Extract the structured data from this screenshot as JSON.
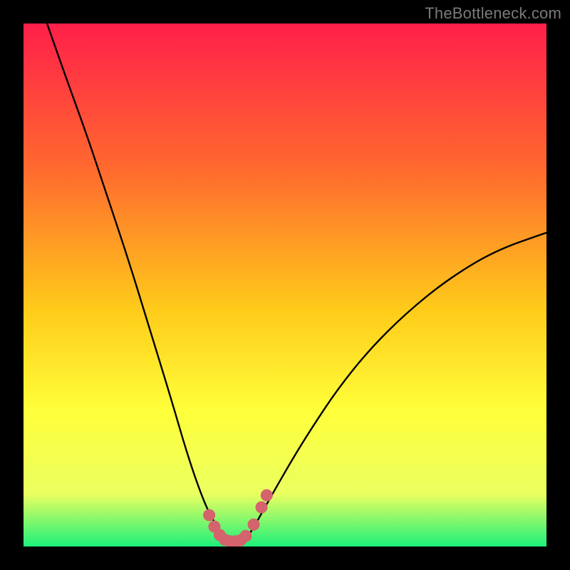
{
  "watermark": "TheBottleneck.com",
  "colors": {
    "bg_black": "#000000",
    "grad_top": "#ff1f4a",
    "grad_mid1": "#ff6a2e",
    "grad_mid2": "#ffcc1a",
    "grad_mid3": "#ffff3a",
    "grad_mid4": "#eaff60",
    "grad_bottom": "#1df07a",
    "curve": "#000000",
    "marker_fill": "#d5636d",
    "marker_stroke": "#d5636d",
    "watermark": "#7a7a7a"
  },
  "chart_data": {
    "type": "line",
    "title": "",
    "xlabel": "",
    "ylabel": "",
    "xlim": [
      0,
      1
    ],
    "ylim": [
      0,
      1
    ],
    "legend": false,
    "grid": false,
    "series": [
      {
        "name": "curve",
        "comment": "black v-shaped curve; x in [0,1], y = relative height (0 bottom, 1 top)",
        "x": [
          0.045,
          0.08,
          0.12,
          0.16,
          0.2,
          0.24,
          0.28,
          0.315,
          0.345,
          0.365,
          0.385,
          0.4,
          0.415,
          0.43,
          0.445,
          0.47,
          0.51,
          0.55,
          0.6,
          0.66,
          0.73,
          0.81,
          0.9,
          1.0
        ],
        "y": [
          1.0,
          0.9,
          0.79,
          0.67,
          0.55,
          0.42,
          0.29,
          0.17,
          0.085,
          0.045,
          0.02,
          0.01,
          0.01,
          0.02,
          0.045,
          0.09,
          0.16,
          0.225,
          0.3,
          0.375,
          0.445,
          0.51,
          0.565,
          0.6
        ]
      }
    ],
    "markers": {
      "name": "points",
      "comment": "salmon dots near the trough",
      "x": [
        0.355,
        0.365,
        0.375,
        0.385,
        0.395,
        0.405,
        0.415,
        0.425,
        0.44,
        0.455,
        0.465
      ],
      "y": [
        0.06,
        0.038,
        0.022,
        0.013,
        0.01,
        0.01,
        0.012,
        0.02,
        0.042,
        0.075,
        0.098
      ],
      "r": 8
    }
  }
}
